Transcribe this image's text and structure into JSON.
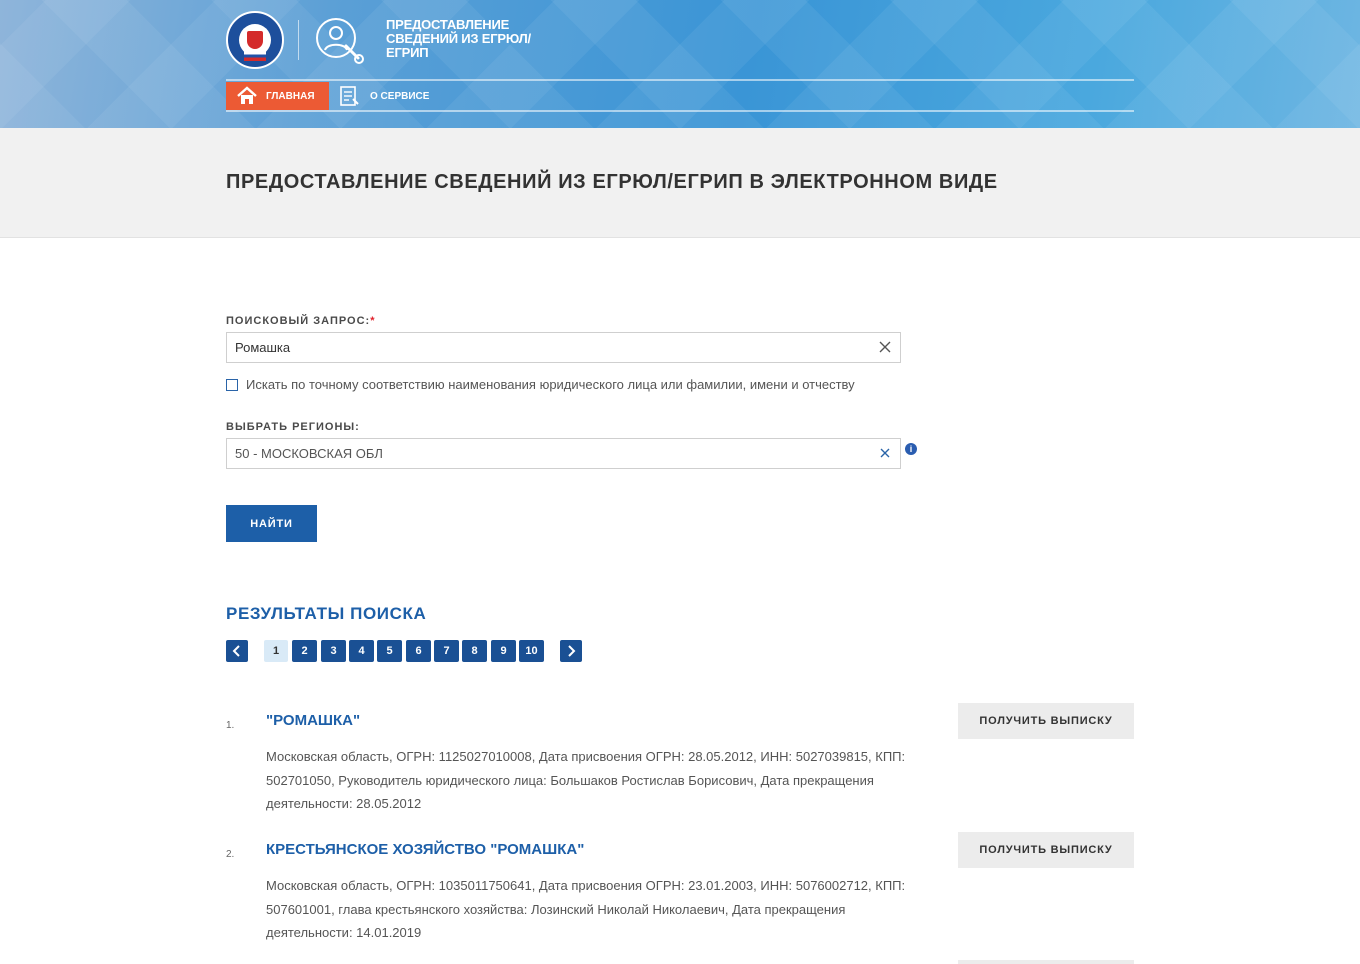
{
  "header": {
    "service_title": "Предоставление сведений из ЕГРЮЛ/ЕГРИП",
    "nav": [
      {
        "label": "Главная",
        "active": true
      },
      {
        "label": "О сервисе",
        "active": false
      }
    ],
    "accent_color": "#ec5a34"
  },
  "page": {
    "title": "ПРЕДОСТАВЛЕНИЕ СВЕДЕНИЙ ИЗ ЕГРЮЛ/ЕГРИП В ЭЛЕКТРОННОМ ВИДЕ"
  },
  "form": {
    "query_label": "ПОИСКОВЫЙ ЗАПРОС:",
    "query_required_mark": "*",
    "query_value": "Ромашка",
    "exact_match_label": "Искать по точному соответствию наименования юридического лица или фамилии, имени и отчеству",
    "exact_match_checked": false,
    "region_label": "ВЫБРАТЬ РЕГИОНЫ:",
    "region_value": "50 - МОСКОВСКАЯ ОБЛ",
    "find_button": "НАЙТИ"
  },
  "results": {
    "title": "РЕЗУЛЬТАТЫ ПОИСКА",
    "pages": [
      "1",
      "2",
      "3",
      "4",
      "5",
      "6",
      "7",
      "8",
      "9",
      "10"
    ],
    "current_page": "1",
    "items": [
      {
        "num": "1.",
        "name": "\"РОМАШКА\"",
        "description": "Московская область, ОГРН: 1125027010008, Дата присвоения ОГРН: 28.05.2012, ИНН: 5027039815, КПП: 502701050, Руководитель юридического лица: Большаков Ростислав Борисович, Дата прекращения деятельности: 28.05.2012",
        "button": "ПОЛУЧИТЬ ВЫПИСКУ"
      },
      {
        "num": "2.",
        "name": "КРЕСТЬЯНСКОЕ ХОЗЯЙСТВО \"РОМАШКА\"",
        "description": "Московская область, ОГРН: 1035011750641, Дата присвоения ОГРН: 23.01.2003, ИНН: 5076002712, КПП: 507601001, глава крестьянского хозяйства: Лозинский Николай Николаевич, Дата прекращения деятельности: 14.01.2019",
        "button": "ПОЛУЧИТЬ ВЫПИСКУ"
      }
    ]
  }
}
